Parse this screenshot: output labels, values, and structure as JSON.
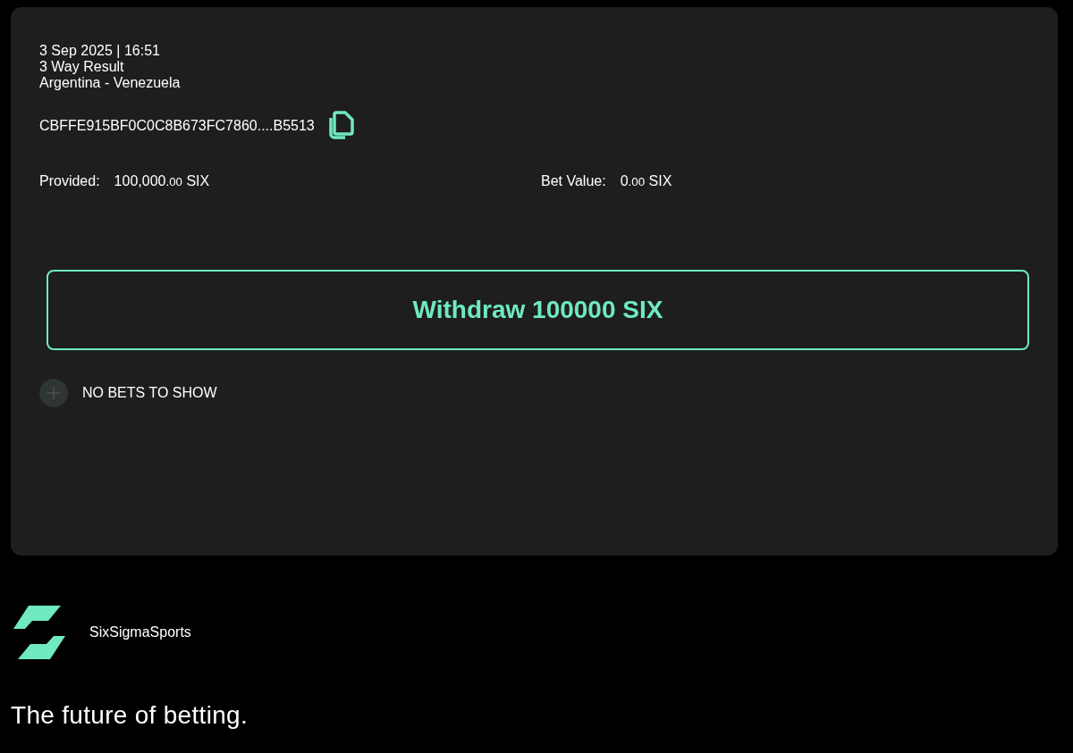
{
  "bet": {
    "date": "3 Sep 2025 | 16:51",
    "market": "3 Way Result",
    "event": "Argentina - Venezuela",
    "hash": "CBFFE915BF0C0C8B673FC7860....B5513",
    "amounts": [
      {
        "label": "Provided:",
        "whole": "100,000",
        "decimals": ".00",
        "unit": "SIX"
      },
      {
        "label": "Bet Value:",
        "whole": "0",
        "decimals": ".00",
        "unit": "SIX"
      }
    ],
    "withdraw_button": "Withdraw 100000 SIX",
    "empty_message": "NO BETS TO SHOW"
  },
  "footer": {
    "brand": "SixSigmaSports",
    "tagline": "The future of betting."
  }
}
